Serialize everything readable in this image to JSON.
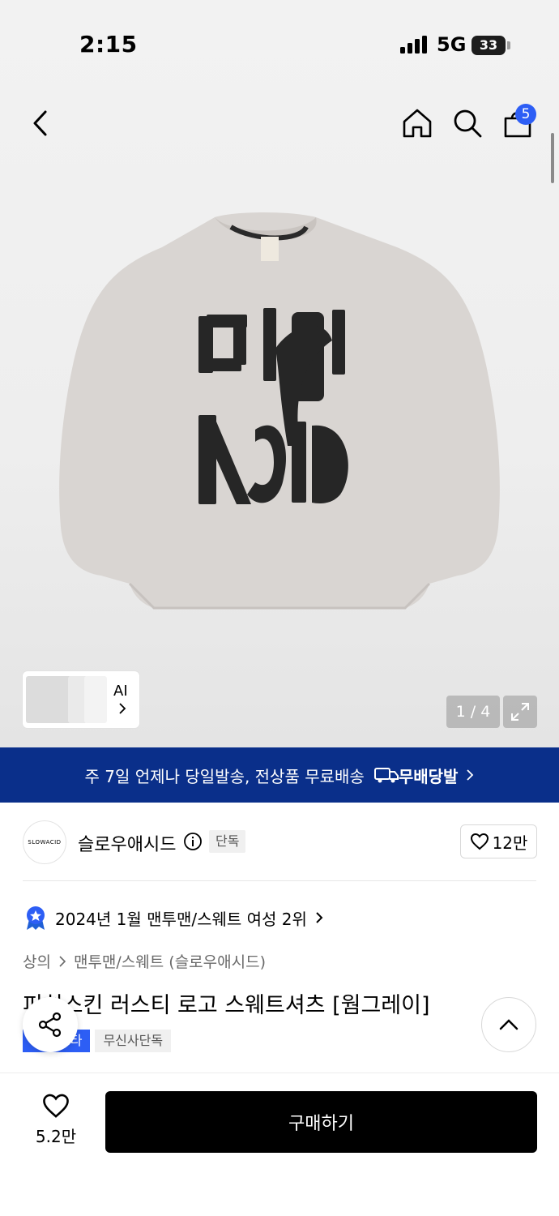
{
  "status_bar": {
    "time": "2:15",
    "network": "5G",
    "battery": "33"
  },
  "nav": {
    "cart_count": "5"
  },
  "gallery": {
    "ai_label": "AI",
    "pager": "1 / 4",
    "logo_text": "SLOW ACID"
  },
  "banner": {
    "text": "주 7일 언제나 당일발송, 전상품 무료배송",
    "badge": "무배당발"
  },
  "brand": {
    "logo_text": "SLOWACID",
    "name": "슬로우애시드",
    "exclusive_tag": "단독",
    "likes": "12만"
  },
  "ranking": {
    "text": "2024년 1월 맨투맨/스웨트 여성 2위"
  },
  "breadcrumb": {
    "category": "상의",
    "subcategory": "맨투맨/스웨트 (슬로우애시드)"
  },
  "product": {
    "title": "피치스킨 러스티 로고 스웨트셔츠 [웜그레이]",
    "tags": [
      "스타",
      "무신사단독"
    ]
  },
  "bottom_bar": {
    "wish_count": "5.2만",
    "buy_label": "구매하기"
  },
  "colors": {
    "brand_blue": "#0a2f8a",
    "badge_blue": "#2d5ef5",
    "sweater": "#d9d5d2",
    "buy_button": "#000000"
  }
}
